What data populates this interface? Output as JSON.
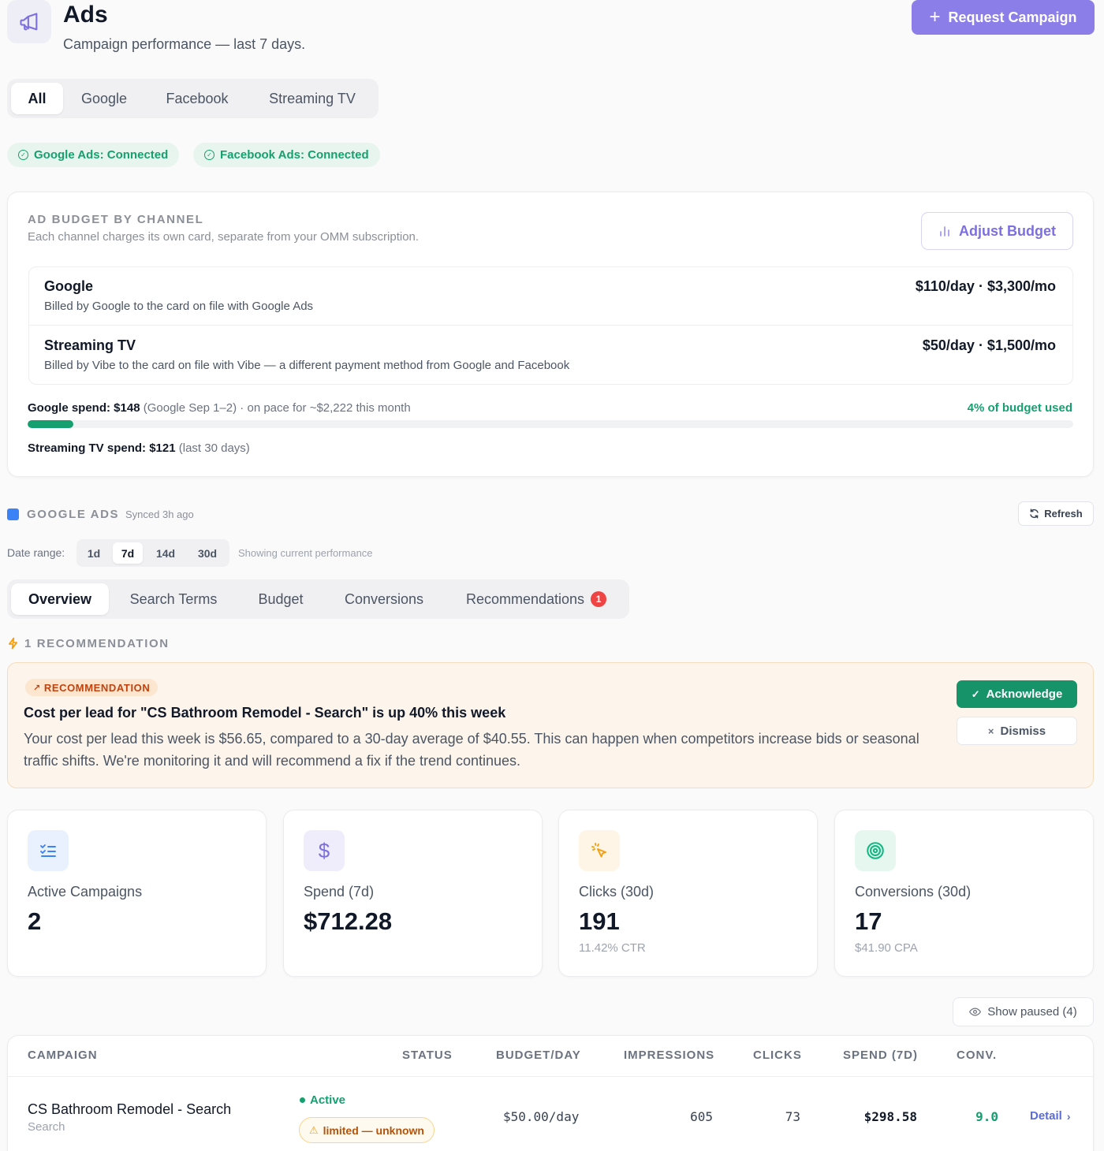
{
  "header": {
    "title": "Ads",
    "subtitle": "Campaign performance — last 7 days.",
    "request_button": "Request Campaign",
    "icon": "megaphone-icon"
  },
  "channel_tabs": [
    "All",
    "Google",
    "Facebook",
    "Streaming TV"
  ],
  "connections": [
    "Google Ads: Connected",
    "Facebook Ads: Connected"
  ],
  "budget": {
    "label": "AD BUDGET BY CHANNEL",
    "description": "Each channel charges its own card, separate from your OMM subscription.",
    "adjust_button": "Adjust Budget",
    "channels": [
      {
        "name": "Google",
        "desc": "Billed by Google to the card on file with Google Ads",
        "price": "$110/day · $3,300/mo"
      },
      {
        "name": "Streaming TV",
        "desc": "Billed by Vibe to the card on file with Vibe — a different payment method from Google and Facebook",
        "price": "$50/day · $1,500/mo"
      }
    ],
    "google_spend_label": "Google spend:",
    "google_spend_value": "$148",
    "google_spend_period": "(Google Sep 1–2)",
    "google_spend_pace": " · on pace for ~$2,222 this month",
    "budget_used": "4% of budget used",
    "budget_used_fraction": 0.044,
    "tv_spend_label": "Streaming TV spend:",
    "tv_spend_value": "$121",
    "tv_spend_period": "(last 30 days)"
  },
  "google_ads": {
    "label": "GOOGLE ADS",
    "synced": "Synced 3h ago",
    "refresh_button": "Refresh",
    "date_range_label": "Date range:",
    "date_options": [
      "1d",
      "7d",
      "14d",
      "30d"
    ],
    "date_selected": "7d",
    "date_note": "Showing current performance",
    "tabs": [
      "Overview",
      "Search Terms",
      "Budget",
      "Conversions",
      "Recommendations"
    ],
    "recommendations_badge": "1"
  },
  "recommendation": {
    "heading": "1 RECOMMENDATION",
    "tag": "RECOMMENDATION",
    "title": "Cost per lead for \"CS Bathroom Remodel - Search\" is up 40% this week",
    "body": "Your cost per lead this week is $56.65, compared to a 30-day average of $40.55. This can happen when competitors increase bids or seasonal traffic shifts. We're monitoring it and will recommend a fix if the trend continues.",
    "acknowledge": "Acknowledge",
    "dismiss": "Dismiss"
  },
  "stats": [
    {
      "label": "Active Campaigns",
      "value": "2",
      "sub": "",
      "icon": "checklist-icon",
      "color": "#3b82f6",
      "bg": "#eaf1fe"
    },
    {
      "label": "Spend (7d)",
      "value": "$712.28",
      "sub": "",
      "icon": "dollar-icon",
      "color": "#7c6fe0",
      "bg": "#efedfb"
    },
    {
      "label": "Clicks (30d)",
      "value": "191",
      "sub": "11.42% CTR",
      "icon": "cursor-click-icon",
      "color": "#f59e0b",
      "bg": "#fef5e6"
    },
    {
      "label": "Conversions (30d)",
      "value": "17",
      "sub": "$41.90 CPA",
      "icon": "target-icon",
      "color": "#10b981",
      "bg": "#e6f7f0"
    }
  ],
  "show_paused": "Show paused (4)",
  "table": {
    "columns": [
      "CAMPAIGN",
      "STATUS",
      "BUDGET/DAY",
      "IMPRESSIONS",
      "CLICKS",
      "SPEND (7D)",
      "CONV."
    ],
    "rows": [
      {
        "name": "CS Bathroom Remodel - Search",
        "type": "Search",
        "status": "Active",
        "limited": "limited — unknown",
        "budget": "$50.00/day",
        "impressions": "605",
        "clicks": "73",
        "spend": "$298.58",
        "conv": "9.0",
        "detail": "Detail"
      }
    ]
  }
}
